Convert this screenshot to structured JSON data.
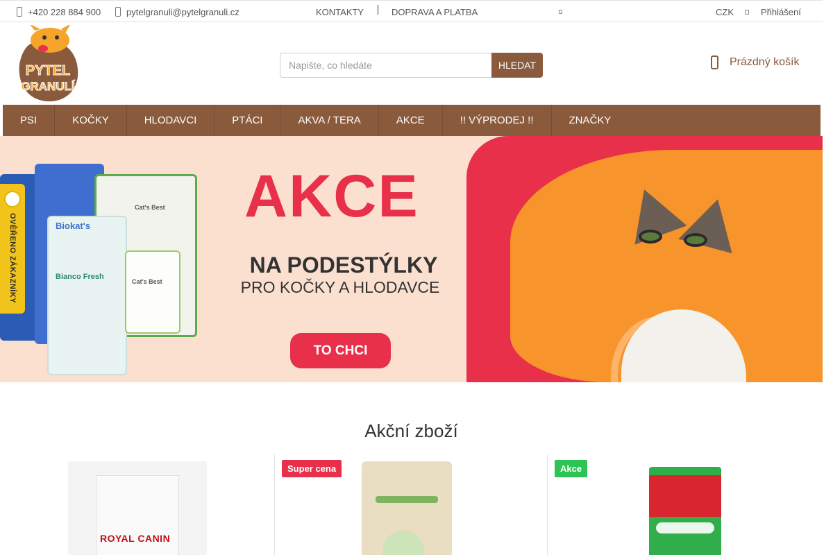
{
  "topbar": {
    "phone": "+420 228 884 900",
    "email": "pytelgranuli@pytelgranuli.cz",
    "links": [
      "KONTAKTY",
      "DOPRAVA A PLATBA"
    ],
    "currency": "CZK",
    "login": "Přihlášení"
  },
  "logo": {
    "line1": "PYTEL",
    "line2": "GRANULÍ"
  },
  "search": {
    "placeholder": "Napište, co hledáte",
    "button": "HLEDAT"
  },
  "cart": {
    "label": "Prázdný košík"
  },
  "nav": {
    "items": [
      "PSI",
      "KOČKY",
      "HLODAVCI",
      "PTÁCI",
      "AKVA / TERA",
      "AKCE",
      "!! VÝPRODEJ !!",
      "ZNAČKY"
    ]
  },
  "banner": {
    "title": "AKCE",
    "subtitle1": "NA PODESTÝLKY",
    "subtitle2": "PRO KOČKY A HLODAVCE",
    "cta": "TO CHCI",
    "bag_texts": [
      "Biokat's",
      "Bianco Fresh",
      "Cat's Best",
      "Cat's Best"
    ]
  },
  "verified": {
    "text": "OVĚŘENO ZÁKAZNÍKY"
  },
  "products": {
    "title": "Akční zboží",
    "items": [
      {
        "brand": "ROYAL CANIN",
        "badge": ""
      },
      {
        "brand": "",
        "badge": "Super cena"
      },
      {
        "brand": "",
        "badge": "Akce"
      }
    ]
  },
  "colors": {
    "brand_brown": "#8a5a3c",
    "akce_red": "#e8304b",
    "badge_red": "#e8304b",
    "badge_green": "#2ec455"
  }
}
